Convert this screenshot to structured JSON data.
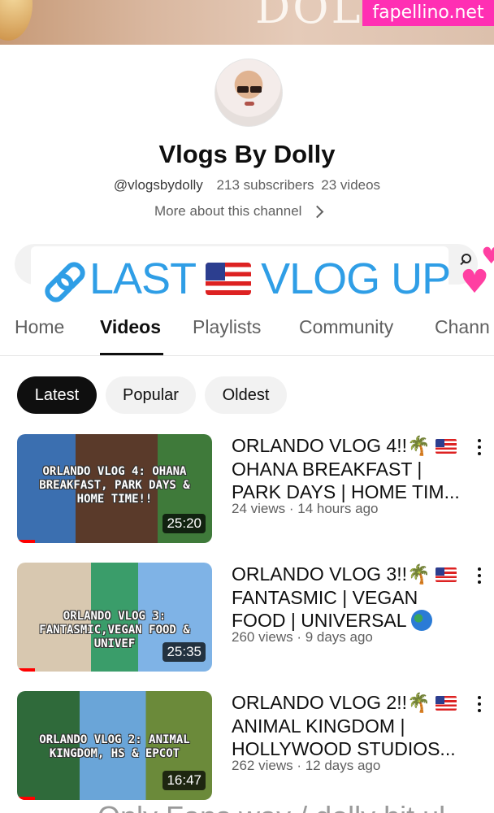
{
  "banner": {
    "text": "DOLL",
    "watermark": "fapellino.net"
  },
  "channel": {
    "name": "Vlogs By Dolly",
    "handle": "@vlogsbydolly",
    "subscribers": "213 subscribers",
    "videos_count": "23 videos",
    "more_label": "More about this channel"
  },
  "overlay": {
    "text_1": "LAST",
    "text_2": "VLOG UP",
    "link_icon": "link-icon",
    "flag_icon": "us-flag-icon",
    "hearts_icon": "two-hearts-icon"
  },
  "tabs": [
    "Home",
    "Videos",
    "Playlists",
    "Community",
    "Chann"
  ],
  "active_tab": "Videos",
  "filters": [
    "Latest",
    "Popular",
    "Oldest"
  ],
  "active_filter": "Latest",
  "videos": [
    {
      "title_prefix": "ORLANDO VLOG 4!!",
      "title_rest": "OHANA BREAKFAST | PARK DAYS | HOME TIM...",
      "meta": "24 views · 14 hours ago",
      "thumb_caption": "ORLANDO VLOG 4: OHANA BREAKFAST, PARK DAYS & HOME TIME!!",
      "duration": "25:20"
    },
    {
      "title_prefix": "ORLANDO VLOG 3!!",
      "title_rest": "FANTASMIC | VEGAN FOOD | UNIVERSAL",
      "meta": "260 views · 9 days ago",
      "thumb_caption": "ORLANDO VLOG 3: FANTASMIC,VEGAN FOOD & UNIVEF",
      "duration": "25:35"
    },
    {
      "title_prefix": "ORLANDO VLOG 2!!",
      "title_rest": "ANIMAL KINGDOM | HOLLYWOOD STUDIOS...",
      "meta": "262 views · 12 days ago",
      "thumb_caption": "ORLANDO VLOG 2: ANIMAL KINGDOM, HS & EPCOT",
      "duration": "16:47"
    }
  ],
  "bottom_peek": "Only Fans way / dolly hit ul",
  "colors": {
    "accent_blue": "#2f9ee6",
    "watermark_pink": "#ff2fb3",
    "progress_red": "#ff0000"
  }
}
